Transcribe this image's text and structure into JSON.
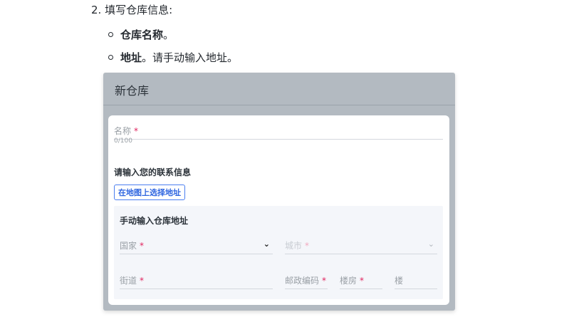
{
  "instructions": {
    "step": "2. 填写仓库信息:",
    "bullet1_bold": "仓库名称",
    "bullet1_rest": "。",
    "bullet2_bold": "地址",
    "bullet2_rest": "。请手动输入地址。"
  },
  "dialog": {
    "title": "新仓库",
    "name_label": "名称",
    "required_mark": "*",
    "name_counter": "0/100",
    "contact_heading": "请输入您的联系信息",
    "map_button": "在地图上选择地址",
    "manual_heading": "手动输入仓库地址",
    "fields": {
      "country": "国家",
      "city": "城市",
      "street": "街道",
      "postal": "邮政编码",
      "building": "楼房",
      "floor": "楼"
    }
  }
}
